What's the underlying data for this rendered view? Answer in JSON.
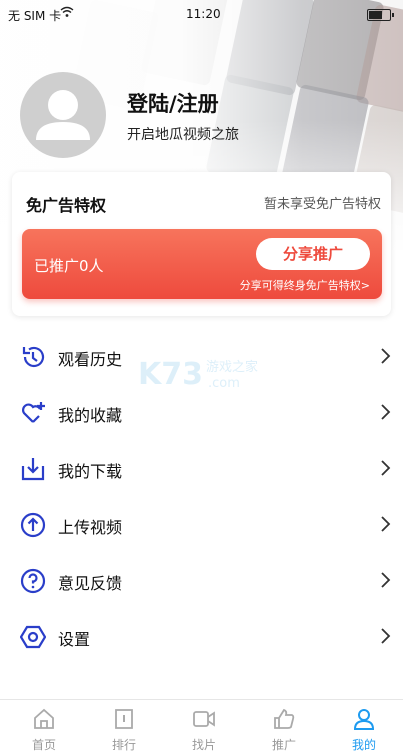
{
  "status": {
    "carrier": "无 SIM 卡",
    "time": "11:20"
  },
  "profile": {
    "title": "登陆/注册",
    "subtitle": "开启地瓜视频之旅"
  },
  "ad_free": {
    "title": "免广告特权",
    "note": "暂未享受免广告特权",
    "promoted": "已推广0人",
    "share_button": "分享推广",
    "hint": "分享可得终身免广告特权>"
  },
  "menu": [
    {
      "label": "观看历史",
      "icon": "history-icon"
    },
    {
      "label": "我的收藏",
      "icon": "favorite-heart-icon"
    },
    {
      "label": "我的下载",
      "icon": "download-icon"
    },
    {
      "label": "上传视频",
      "icon": "upload-icon"
    },
    {
      "label": "意见反馈",
      "icon": "feedback-icon"
    },
    {
      "label": "设置",
      "icon": "settings-icon"
    }
  ],
  "watermark": {
    "brand": "K73",
    "text": "游戏之家",
    "domain": ".com"
  },
  "tabs": [
    {
      "label": "首页",
      "icon": "home-icon"
    },
    {
      "label": "排行",
      "icon": "ranking-icon"
    },
    {
      "label": "找片",
      "icon": "video-search-icon"
    },
    {
      "label": "推广",
      "icon": "promote-icon"
    },
    {
      "label": "我的",
      "icon": "profile-icon",
      "active": true
    }
  ],
  "colors": {
    "accent_blue": "#1e9bf0",
    "icon_blue": "#2a3ec9",
    "promo_red": "#ee4a3d"
  }
}
